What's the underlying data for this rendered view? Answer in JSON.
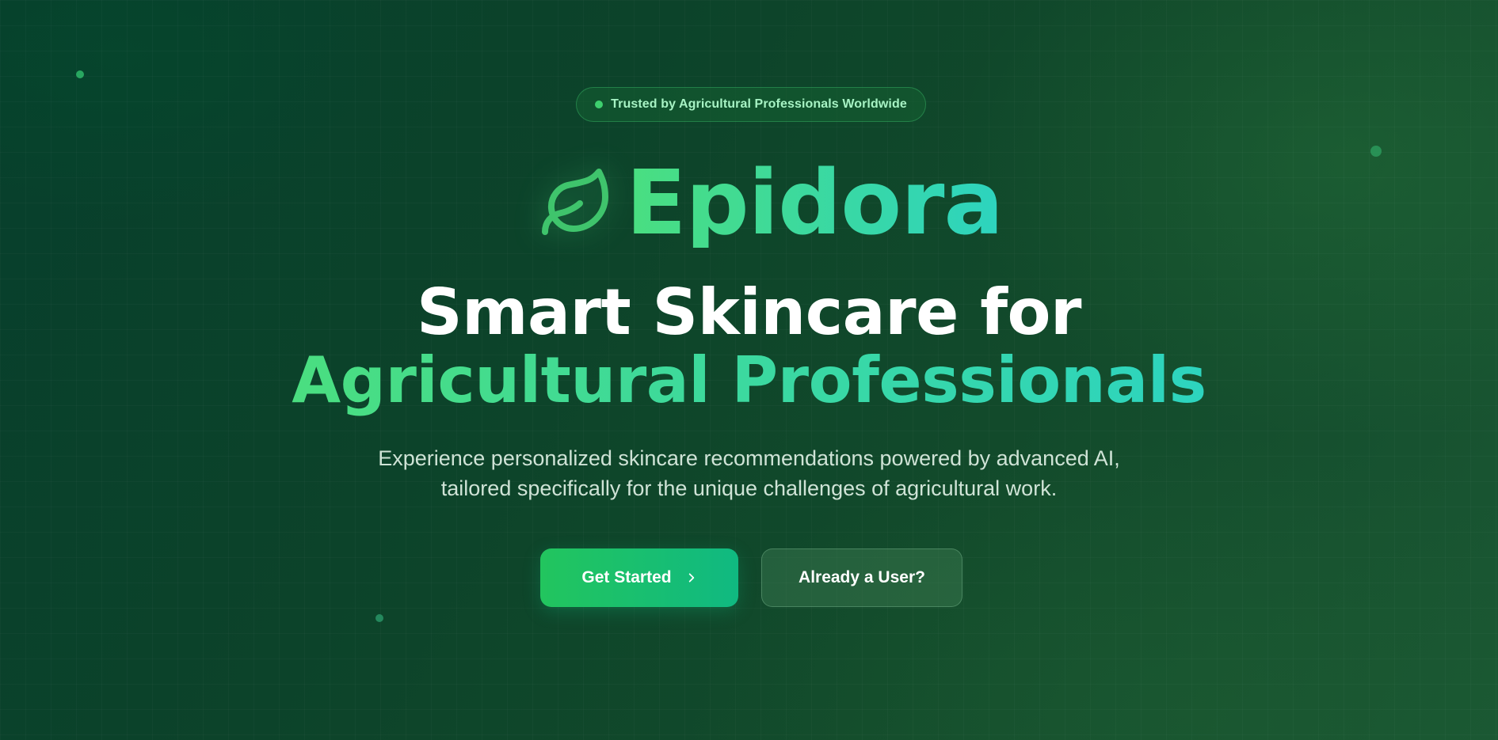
{
  "badge": {
    "text": "Trusted by Agricultural Professionals Worldwide"
  },
  "brand": {
    "name": "Epidora",
    "icon": "leaf-icon"
  },
  "hero": {
    "headline_line1": "Smart Skincare for",
    "headline_line2": "Agricultural Professionals",
    "subtitle_line1": "Experience personalized skincare recommendations powered by advanced AI,",
    "subtitle_line2": "tailored specifically for the unique challenges of agricultural work."
  },
  "actions": {
    "primary_label": "Get Started",
    "primary_icon": "chevron-right-icon",
    "secondary_label": "Already a User?"
  },
  "colors": {
    "accent_green": "#4ade80",
    "accent_teal": "#2dd4bf",
    "background_dark": "#0c432a",
    "button_primary": "#22c55e"
  }
}
